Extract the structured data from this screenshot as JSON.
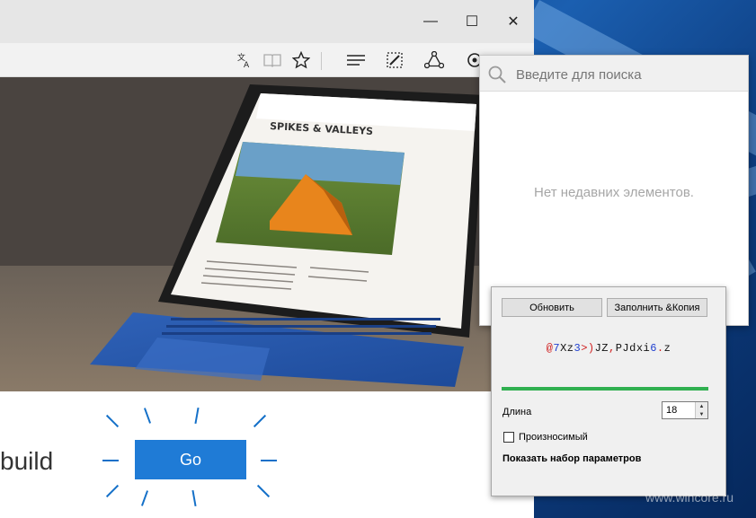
{
  "browser": {
    "window_controls": {
      "minimize": "—",
      "maximize": "☐",
      "close": "✕"
    },
    "toolbar_icons": [
      "translate-icon",
      "reading-view-icon",
      "favorite-star-icon",
      "hub-icon",
      "web-note-icon",
      "share-icon",
      "extension-icon"
    ]
  },
  "page": {
    "build_text": "build",
    "go_button": "Go"
  },
  "search_panel": {
    "placeholder": "Введите для поиска",
    "empty_message": "Нет недавних элементов."
  },
  "password_generator": {
    "refresh_button": "Обновить",
    "fill_copy_button": "Заполнить &Копия",
    "generated_password": [
      {
        "t": "@",
        "k": "sym"
      },
      {
        "t": "7",
        "k": "num"
      },
      {
        "t": "X",
        "k": "chr"
      },
      {
        "t": "z",
        "k": "chr"
      },
      {
        "t": "3",
        "k": "num"
      },
      {
        "t": ">",
        "k": "sym"
      },
      {
        "t": ")",
        "k": "sym"
      },
      {
        "t": "J",
        "k": "chr"
      },
      {
        "t": "Z",
        "k": "chr"
      },
      {
        "t": ",",
        "k": "sym"
      },
      {
        "t": "P",
        "k": "chr"
      },
      {
        "t": "J",
        "k": "chr"
      },
      {
        "t": "d",
        "k": "chr"
      },
      {
        "t": "x",
        "k": "chr"
      },
      {
        "t": "i",
        "k": "chr"
      },
      {
        "t": "6",
        "k": "num"
      },
      {
        "t": ".",
        "k": "sym"
      },
      {
        "t": "z",
        "k": "chr"
      }
    ],
    "strength_fraction": 1.0,
    "strength_color": "#30b050",
    "length_label": "Длина",
    "length_value": "18",
    "pronounceable_label": "Произносимый",
    "pronounceable_checked": false,
    "show_params_label": "Показать набор параметров"
  },
  "watermark": "www.wincore.ru",
  "colors": {
    "go_button": "#1f7bd6",
    "accent_rays": "#1470c8"
  }
}
